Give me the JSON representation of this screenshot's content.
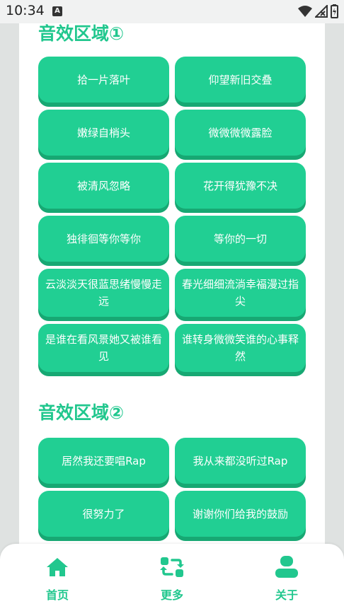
{
  "status_bar": {
    "time": "10:34",
    "notification_icon": "A"
  },
  "section1": {
    "title": "音效区域①",
    "buttons": [
      "拾一片落叶",
      "仰望新旧交叠",
      "嫩绿自梢头",
      "微微微微露脸",
      "被清风忽略",
      "花开得犹豫不决",
      "独徘徊等你等你",
      "等你的一切",
      "云淡淡天很蓝思绪慢慢走远",
      "春光细细流淌幸福漫过指尖",
      "是谁在看风景她又被谁看见",
      "谁转身微微笑谁的心事释然"
    ]
  },
  "section2": {
    "title": "音效区域②",
    "buttons": [
      "居然我还要唱Rap",
      "我从来都没听过Rap",
      "很努力了",
      "谢谢你们给我的鼓励"
    ]
  },
  "bottom_nav": {
    "items": [
      {
        "label": "首页",
        "icon": "home-icon"
      },
      {
        "label": "更多",
        "icon": "refresh-icon"
      },
      {
        "label": "关于",
        "icon": "person-icon"
      }
    ]
  },
  "colors": {
    "accent": "#21c78e",
    "button": "#21cf93",
    "button_shadow": "#17a873"
  }
}
